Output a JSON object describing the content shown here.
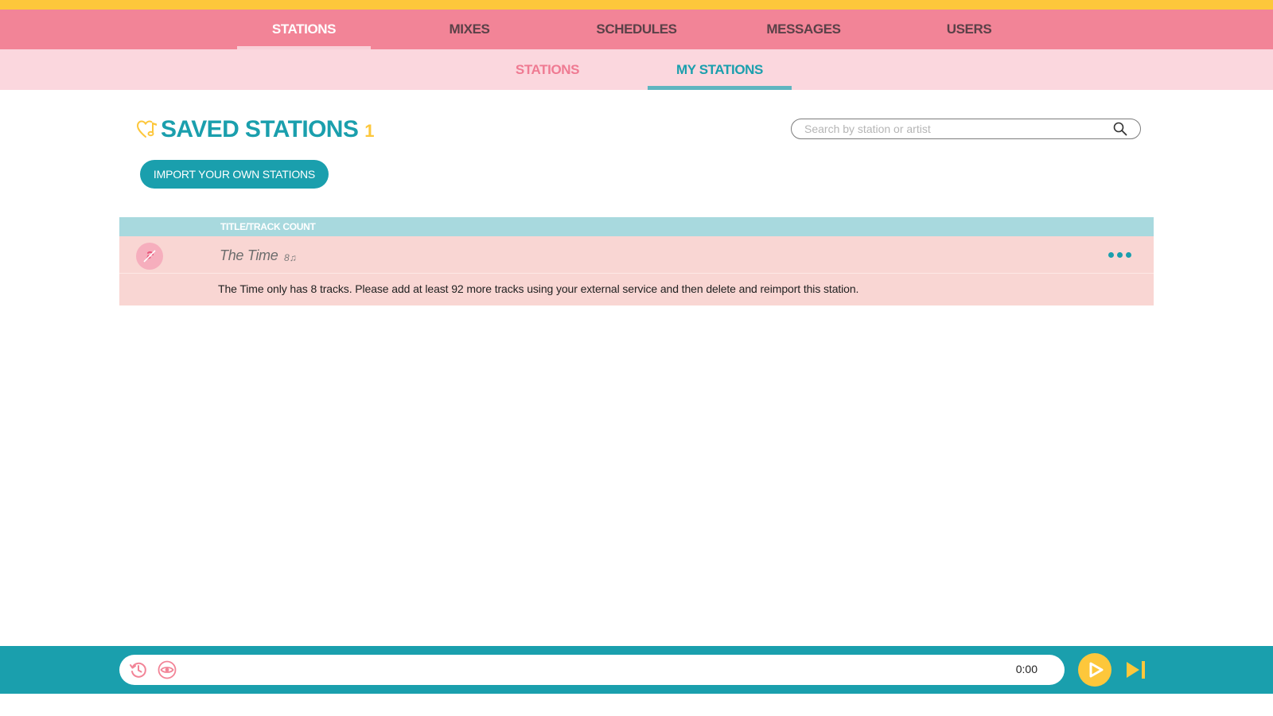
{
  "main_nav": {
    "tabs": [
      {
        "label": "STATIONS",
        "active": true
      },
      {
        "label": "MIXES",
        "active": false
      },
      {
        "label": "SCHEDULES",
        "active": false
      },
      {
        "label": "MESSAGES",
        "active": false
      },
      {
        "label": "USERS",
        "active": false
      }
    ]
  },
  "sub_nav": {
    "tabs": [
      {
        "label": "STATIONS",
        "active": false
      },
      {
        "label": "MY STATIONS",
        "active": true
      }
    ]
  },
  "heading": {
    "title": "SAVED STATIONS",
    "count": "1",
    "icon": "heart-music-note-icon"
  },
  "import_button": {
    "label": "IMPORT YOUR OWN STATIONS"
  },
  "search": {
    "placeholder": "Search by station or artist",
    "value": "",
    "icon": "search-icon"
  },
  "table": {
    "header": {
      "title_col": "TITLE/TRACK COUNT"
    },
    "rows": [
      {
        "title": "The Time",
        "track_count": "8",
        "track_glyph": "♫",
        "note": "The Time only has 8 tracks. Please add at least 92 more tracks using your external service and then delete and reimport this station."
      }
    ]
  },
  "player": {
    "time": "0:00",
    "icons": [
      "history-icon",
      "eye-icon",
      "play-icon",
      "skip-next-icon"
    ]
  },
  "colors": {
    "accent_yellow": "#fdc73b",
    "nav_pink": "#f28497",
    "subnav_pink": "#fbd7de",
    "teal": "#1a9fad",
    "row_pink": "#f9d6d3"
  }
}
